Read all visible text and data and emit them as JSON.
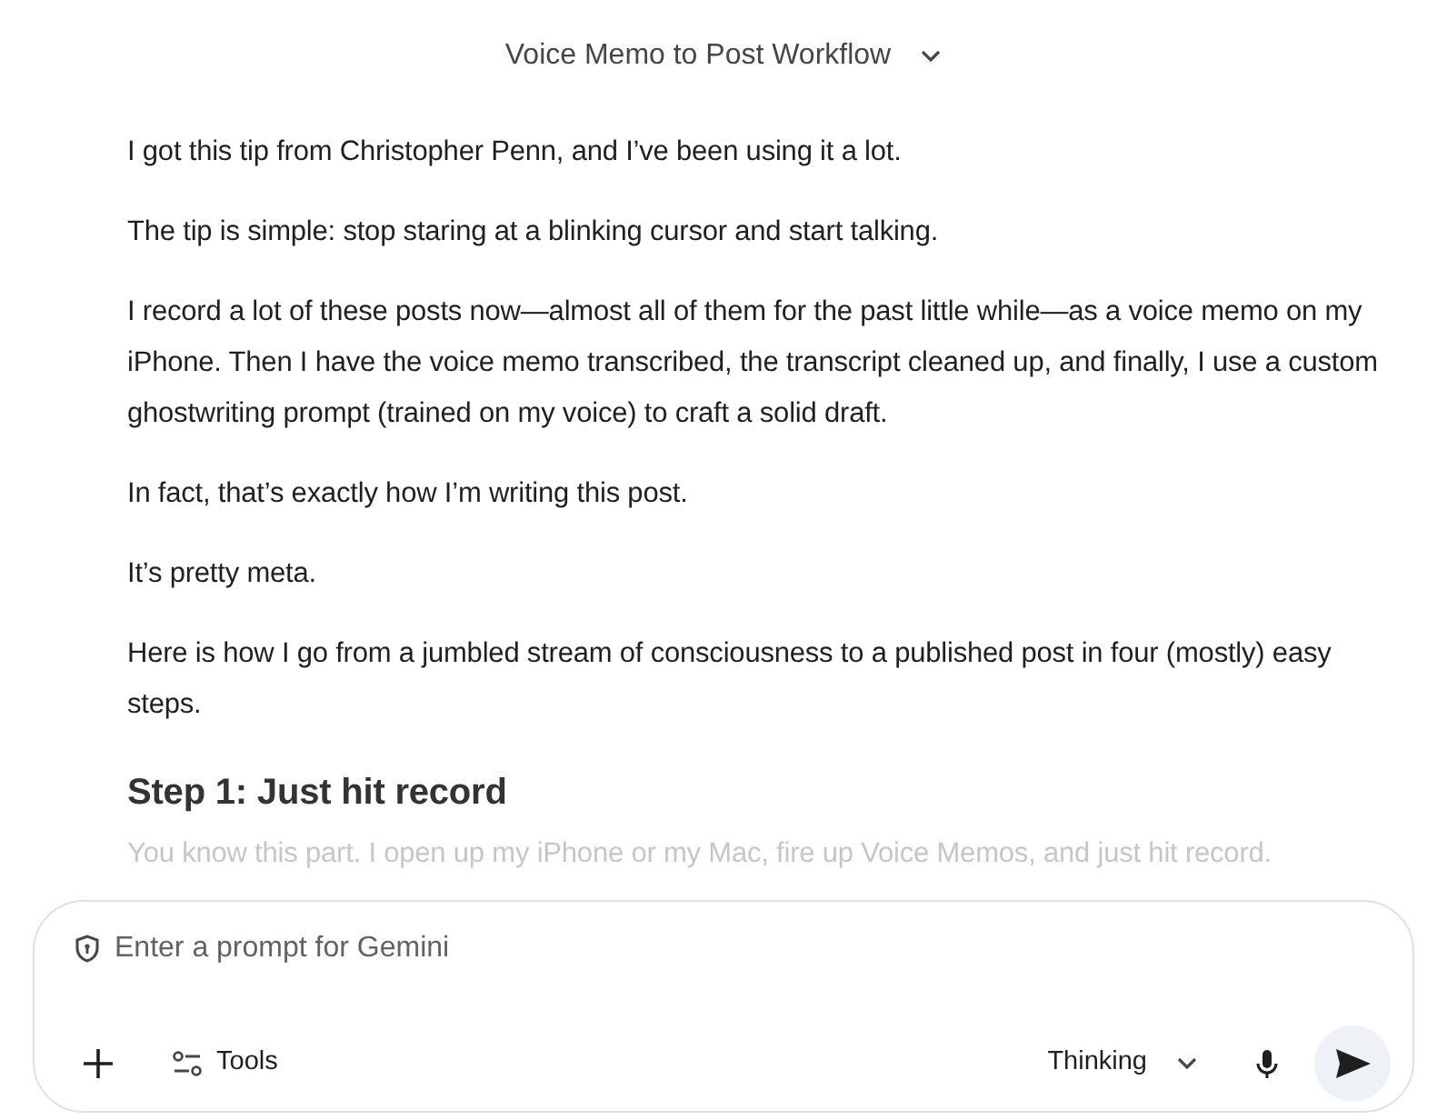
{
  "title": "Voice Memo to Post Workflow",
  "paragraphs": [
    {
      "kind": "text",
      "text": "I got this tip from Christopher Penn, and I’ve been using it a lot."
    },
    {
      "kind": "text",
      "text": "The tip is simple: stop staring at a blinking cursor and start talking."
    },
    {
      "kind": "text",
      "text": "I record a lot of these posts now—almost all of them for the past little while—as a voice memo on my iPhone. Then I have the voice memo transcribed, the transcript cleaned up, and finally, I use a custom ghostwriting prompt (trained on my voice) to craft a solid draft."
    },
    {
      "kind": "text",
      "text": "In fact, that’s exactly how I’m writing this post."
    },
    {
      "kind": "text",
      "text": "It’s pretty meta."
    },
    {
      "kind": "text",
      "text": "Here is how I go from a jumbled stream of consciousness to a published post in four (mostly) easy steps."
    },
    {
      "kind": "heading",
      "text": "Step 1: Just hit record"
    },
    {
      "kind": "faded",
      "text": "You know this part. I open up my iPhone or my Mac, fire up Voice Memos, and just hit record."
    }
  ],
  "prompt": {
    "placeholder": "Enter a prompt for Gemini",
    "tools_label": "Tools",
    "mode": "Thinking"
  }
}
